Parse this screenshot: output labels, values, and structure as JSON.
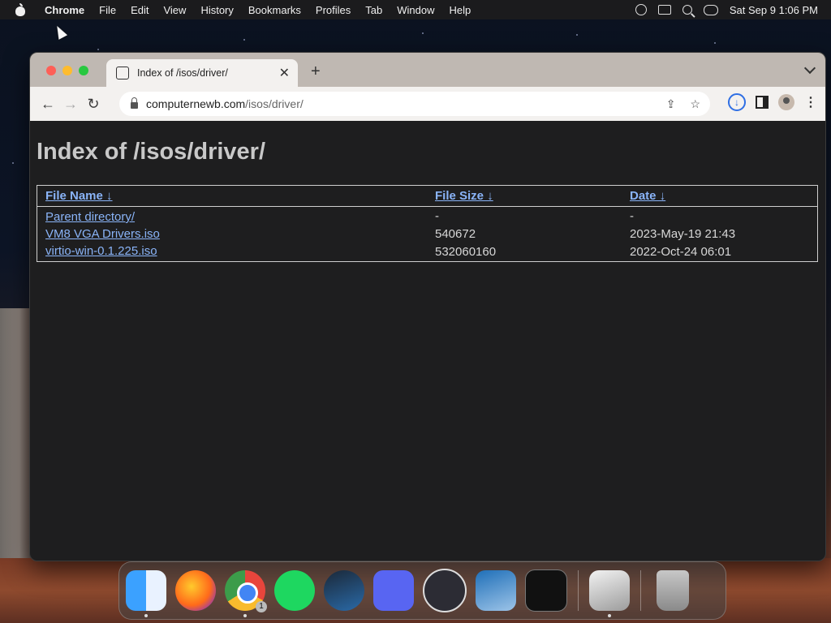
{
  "menubar": {
    "app_name": "Chrome",
    "items": [
      "File",
      "Edit",
      "View",
      "History",
      "Bookmarks",
      "Profiles",
      "Tab",
      "Window",
      "Help"
    ],
    "clock": "Sat Sep 9  1:06 PM"
  },
  "browser": {
    "tab_title": "Index of /isos/driver/",
    "new_tab": "+",
    "close_tab": "✕",
    "url_host": "computernewb.com",
    "url_path": "/isos/driver/"
  },
  "page": {
    "title": "Index of /isos/driver/",
    "columns": [
      "File Name ↓",
      "File Size ↓",
      "Date ↓"
    ],
    "rows": [
      {
        "name": "Parent directory/",
        "size": "-",
        "date": "-"
      },
      {
        "name": "VM8 VGA Drivers.iso",
        "size": "540672",
        "date": "2023-May-19 21:43"
      },
      {
        "name": "virtio-win-0.1.225.iso",
        "size": "532060160",
        "date": "2022-Oct-24 06:01"
      }
    ]
  },
  "dock": {
    "apps": [
      "finder-icon",
      "firefox-icon",
      "chrome-icon",
      "spotify-icon",
      "steam-icon",
      "discord-icon",
      "obs-icon",
      "virtualbox-icon",
      "terminal-icon",
      "bootcamp-icon",
      "trash-icon"
    ],
    "chrome_badge": "1"
  },
  "colors": {
    "page_bg": "#1e1e1f",
    "link": "#8ab4f8",
    "text": "#cfcfcf"
  }
}
